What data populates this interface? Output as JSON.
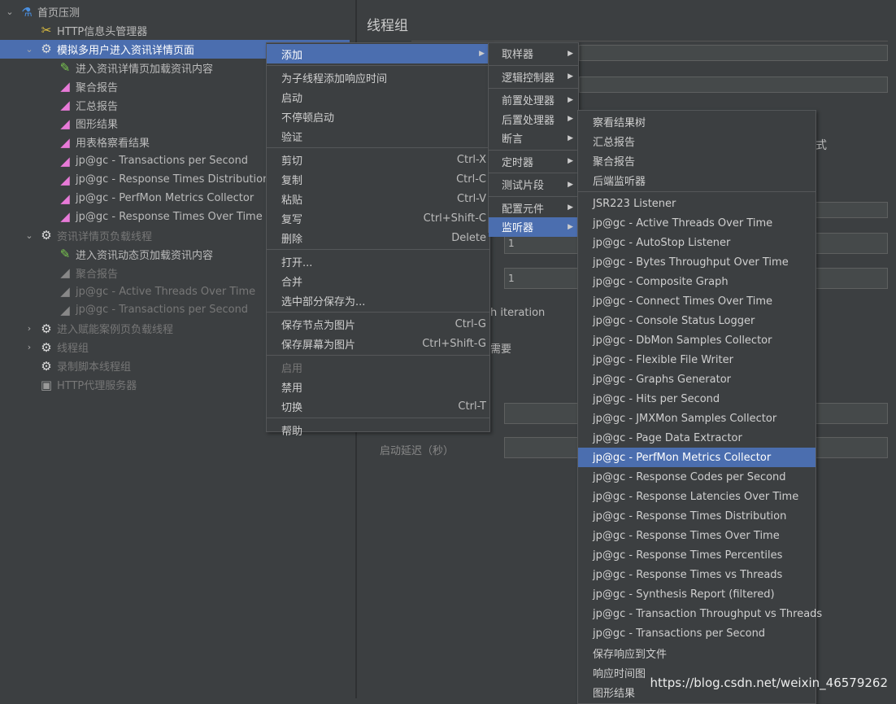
{
  "tree": [
    {
      "label": "首页压测",
      "level": 0,
      "icon": "flask-icon",
      "toggle": "expanded"
    },
    {
      "label": "HTTP信息头管理器",
      "level": 1,
      "icon": "tools-icon"
    },
    {
      "label": "模拟多用户进入资讯详情页面",
      "level": 1,
      "icon": "gear-icon",
      "toggle": "expanded",
      "selected": true
    },
    {
      "label": "进入资讯详情页加载资讯内容",
      "level": 2,
      "icon": "pipette-icon"
    },
    {
      "label": "聚合报告",
      "level": 2,
      "icon": "chart-icon"
    },
    {
      "label": "汇总报告",
      "level": 2,
      "icon": "chart-icon"
    },
    {
      "label": "图形结果",
      "level": 2,
      "icon": "chart-icon"
    },
    {
      "label": "用表格察看结果",
      "level": 2,
      "icon": "chart-icon"
    },
    {
      "label": "jp@gc - Transactions per Second",
      "level": 2,
      "icon": "chart-icon"
    },
    {
      "label": "jp@gc - Response Times Distribution",
      "level": 2,
      "icon": "chart-icon"
    },
    {
      "label": "jp@gc - PerfMon Metrics Collector",
      "level": 2,
      "icon": "chart-icon"
    },
    {
      "label": "jp@gc - Response Times Over Time",
      "level": 2,
      "icon": "chart-icon"
    },
    {
      "label": "资讯详情页负载线程",
      "level": 1,
      "icon": "gear-icon",
      "toggle": "expanded",
      "disabled": true
    },
    {
      "label": "进入资讯动态页加载资讯内容",
      "level": 2,
      "icon": "pipette-icon"
    },
    {
      "label": "聚合报告",
      "level": 2,
      "icon": "chart-icon",
      "disabled": true
    },
    {
      "label": "jp@gc - Active Threads Over Time",
      "level": 2,
      "icon": "chart-icon",
      "disabled": true
    },
    {
      "label": "jp@gc - Transactions per Second",
      "level": 2,
      "icon": "chart-icon",
      "disabled": true
    },
    {
      "label": "进入赋能案例页负载线程",
      "level": 1,
      "icon": "gear-icon",
      "toggle": "collapsed",
      "disabled": true
    },
    {
      "label": "线程组",
      "level": 1,
      "icon": "gear-icon",
      "toggle": "collapsed",
      "disabled": true
    },
    {
      "label": "录制脚本线程组",
      "level": 1,
      "icon": "gear-icon",
      "disabled": true
    },
    {
      "label": "HTTP代理服务器",
      "level": 1,
      "icon": "proxy-icon",
      "disabled": true
    }
  ],
  "right_panel": {
    "title": "线程组",
    "fields": [
      "1",
      "1"
    ],
    "text_iteration": "h iteration",
    "text_need": "需要",
    "text_delay": "启动延迟（秒）",
    "text_cut": "式"
  },
  "context_menu": [
    {
      "label": "添加",
      "submenu": true,
      "highlighted": true
    },
    {
      "sep": true
    },
    {
      "label": "为子线程添加响应时间"
    },
    {
      "label": "启动"
    },
    {
      "label": "不停顿启动"
    },
    {
      "label": "验证"
    },
    {
      "sep": true
    },
    {
      "label": "剪切",
      "shortcut": "Ctrl-X"
    },
    {
      "label": "复制",
      "shortcut": "Ctrl-C"
    },
    {
      "label": "粘贴",
      "shortcut": "Ctrl-V"
    },
    {
      "label": "复写",
      "shortcut": "Ctrl+Shift-C"
    },
    {
      "label": "删除",
      "shortcut": "Delete"
    },
    {
      "sep": true
    },
    {
      "label": "打开..."
    },
    {
      "label": "合并"
    },
    {
      "label": "选中部分保存为..."
    },
    {
      "sep": true
    },
    {
      "label": "保存节点为图片",
      "shortcut": "Ctrl-G"
    },
    {
      "label": "保存屏幕为图片",
      "shortcut": "Ctrl+Shift-G"
    },
    {
      "sep": true
    },
    {
      "label": "启用",
      "disabled": true
    },
    {
      "label": "禁用"
    },
    {
      "label": "切换",
      "shortcut": "Ctrl-T"
    },
    {
      "sep": true
    },
    {
      "label": "帮助"
    }
  ],
  "add_submenu": [
    {
      "label": "取样器",
      "submenu": true
    },
    {
      "sep": true
    },
    {
      "label": "逻辑控制器",
      "submenu": true
    },
    {
      "sep": true
    },
    {
      "label": "前置处理器",
      "submenu": true
    },
    {
      "label": "后置处理器",
      "submenu": true
    },
    {
      "label": "断言",
      "submenu": true
    },
    {
      "sep": true
    },
    {
      "label": "定时器",
      "submenu": true
    },
    {
      "sep": true
    },
    {
      "label": "测试片段",
      "submenu": true
    },
    {
      "sep": true
    },
    {
      "label": "配置元件",
      "submenu": true
    },
    {
      "label": "监听器",
      "submenu": true,
      "highlighted": true
    }
  ],
  "listener_submenu": [
    {
      "label": "察看结果树"
    },
    {
      "label": "汇总报告"
    },
    {
      "label": "聚合报告"
    },
    {
      "label": "后端监听器"
    },
    {
      "sep": true
    },
    {
      "label": "JSR223 Listener"
    },
    {
      "label": "jp@gc - Active Threads Over Time"
    },
    {
      "label": "jp@gc - AutoStop Listener"
    },
    {
      "label": "jp@gc - Bytes Throughput Over Time"
    },
    {
      "label": "jp@gc - Composite Graph"
    },
    {
      "label": "jp@gc - Connect Times Over Time"
    },
    {
      "label": "jp@gc - Console Status Logger"
    },
    {
      "label": "jp@gc - DbMon Samples Collector"
    },
    {
      "label": "jp@gc - Flexible File Writer"
    },
    {
      "label": "jp@gc - Graphs Generator"
    },
    {
      "label": "jp@gc - Hits per Second"
    },
    {
      "label": "jp@gc - JMXMon Samples Collector"
    },
    {
      "label": "jp@gc - Page Data Extractor"
    },
    {
      "label": "jp@gc - PerfMon Metrics Collector",
      "highlighted": true
    },
    {
      "label": "jp@gc - Response Codes per Second"
    },
    {
      "label": "jp@gc - Response Latencies Over Time"
    },
    {
      "label": "jp@gc - Response Times Distribution"
    },
    {
      "label": "jp@gc - Response Times Over Time"
    },
    {
      "label": "jp@gc - Response Times Percentiles"
    },
    {
      "label": "jp@gc - Response Times vs Threads"
    },
    {
      "label": "jp@gc - Synthesis Report (filtered)"
    },
    {
      "label": "jp@gc - Transaction Throughput vs Threads"
    },
    {
      "label": "jp@gc - Transactions per Second"
    },
    {
      "label": "保存响应到文件"
    },
    {
      "label": "响应时间图"
    },
    {
      "label": "图形结果"
    }
  ],
  "watermark": "https://blog.csdn.net/weixin_46579262",
  "colors": {
    "selection": "#4b6eaf",
    "background": "#3c3f41"
  }
}
